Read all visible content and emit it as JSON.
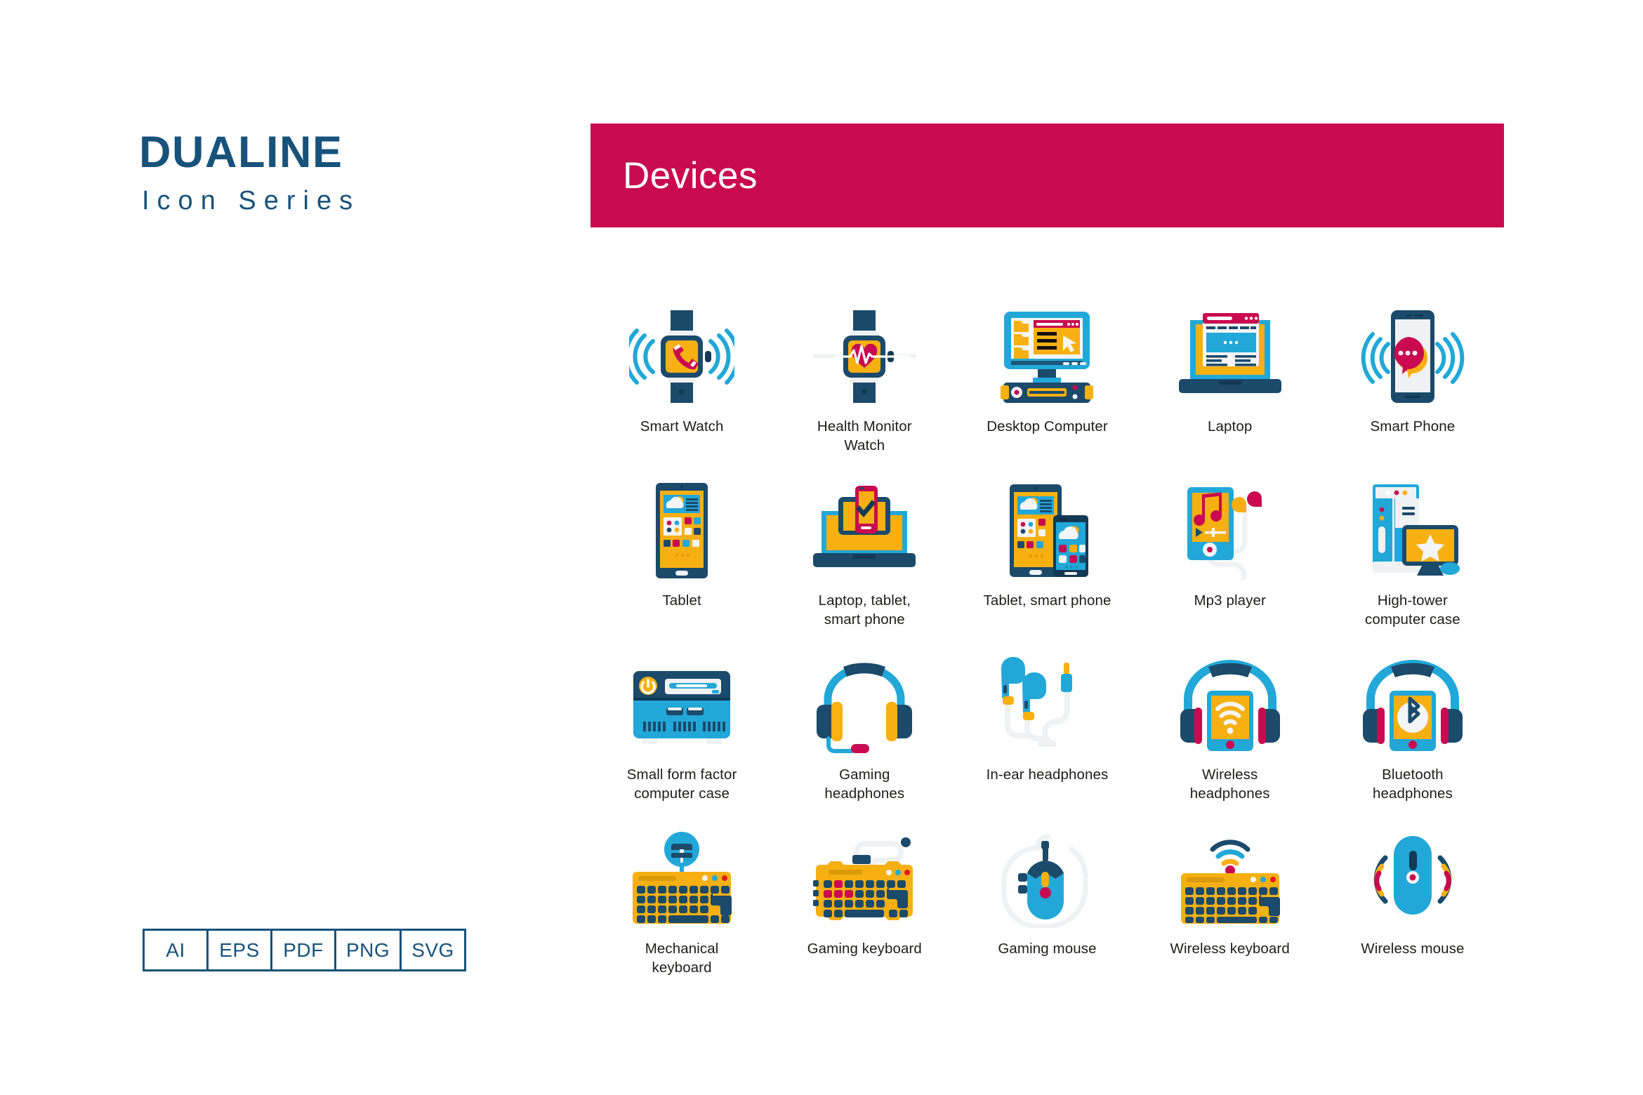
{
  "brand": {
    "title": "DUALINE",
    "subtitle": "Icon Series"
  },
  "formats": [
    {
      "label": "AI"
    },
    {
      "label": "EPS"
    },
    {
      "label": "PDF"
    },
    {
      "label": "PNG"
    },
    {
      "label": "SVG"
    }
  ],
  "banner": {
    "title": "Devices",
    "color": "#c90a50"
  },
  "palette": {
    "dark_blue": "#17527a",
    "deep_navy": "#1b4a6b",
    "cyan": "#21a8d8",
    "yellow": "#f7b011",
    "crimson": "#c90a50",
    "light_grey": "#eef0f1",
    "white": "#ffffff",
    "text": "#1d1d1b"
  },
  "icons": [
    {
      "name": "smart-watch",
      "label": "Smart Watch"
    },
    {
      "name": "health-monitor-watch",
      "label": "Health Monitor Watch"
    },
    {
      "name": "desktop-computer",
      "label": "Desktop Computer"
    },
    {
      "name": "laptop",
      "label": "Laptop"
    },
    {
      "name": "smart-phone",
      "label": "Smart Phone"
    },
    {
      "name": "tablet",
      "label": "Tablet"
    },
    {
      "name": "laptop-tablet-smart-phone",
      "label": "Laptop, tablet, smart phone"
    },
    {
      "name": "tablet-smart-phone",
      "label": "Tablet, smart phone"
    },
    {
      "name": "mp3-player",
      "label": "Mp3 player"
    },
    {
      "name": "high-tower-computer-case",
      "label": "High-tower computer case"
    },
    {
      "name": "small-form-factor-computer-case",
      "label": "Small form factor computer case"
    },
    {
      "name": "gaming-headphones",
      "label": "Gaming headphones"
    },
    {
      "name": "in-ear-headphones",
      "label": "In-ear headphones"
    },
    {
      "name": "wireless-headphones",
      "label": "Wireless headphones"
    },
    {
      "name": "bluetooth-headphones",
      "label": "Bluetooth headphones"
    },
    {
      "name": "mechanical-keyboard",
      "label": "Mechanical keyboard"
    },
    {
      "name": "gaming-keyboard",
      "label": "Gaming keyboard"
    },
    {
      "name": "gaming-mouse",
      "label": "Gaming mouse"
    },
    {
      "name": "wireless-keyboard",
      "label": "Wireless keyboard"
    },
    {
      "name": "wireless-mouse",
      "label": "Wireless mouse"
    }
  ]
}
